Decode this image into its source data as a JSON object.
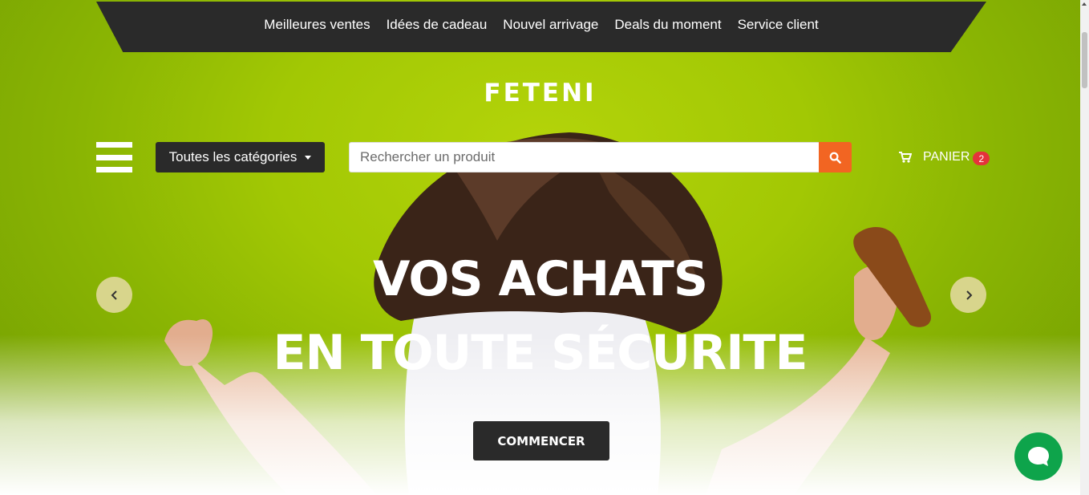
{
  "nav": {
    "items": [
      "Meilleures ventes",
      "Idées de cadeau",
      "Nouvel arrivage",
      "Deals du moment",
      "Service client"
    ]
  },
  "brand": {
    "logo_text": "FETENI"
  },
  "categories": {
    "label": "Toutes les catégories"
  },
  "search": {
    "placeholder": "Rechercher un produit",
    "value": ""
  },
  "cart": {
    "label": "PANIER",
    "count": "2"
  },
  "hero": {
    "line1": "VOS ACHATS",
    "line2": "EN TOUTE SÉCURITE",
    "cta_label": "COMMENCER"
  },
  "icons": {
    "menu": "hamburger-icon",
    "caret": "caret-down-icon",
    "search": "search-icon",
    "cart": "cart-icon",
    "prev": "chevron-left-icon",
    "next": "chevron-right-icon",
    "chat": "chat-bubble-icon"
  },
  "colors": {
    "hero_green": "#a2c804",
    "dark": "#2a2a2a",
    "search_button": "#f26522",
    "badge": "#e5323b",
    "carousel_arrow": "#d8d58c",
    "chat": "#0ea44b"
  }
}
